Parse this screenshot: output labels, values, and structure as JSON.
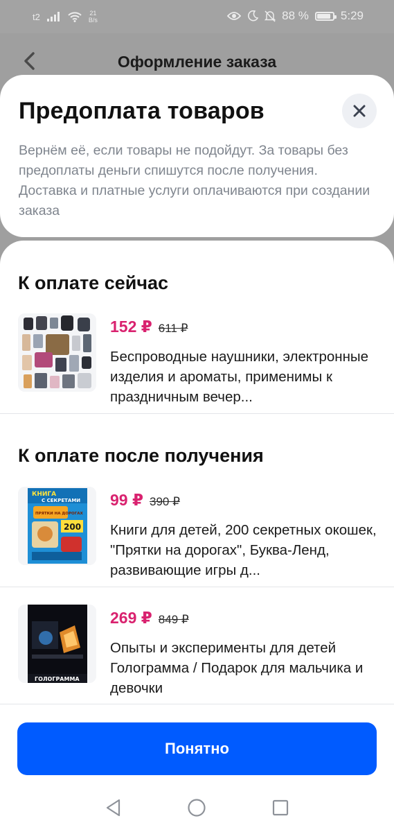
{
  "status_bar": {
    "network": "t2",
    "data_rate": "21",
    "data_rate_unit": "B/s",
    "battery": "88 %",
    "battery_level": 0.88,
    "time": "5:29"
  },
  "header": {
    "title": "Оформление заказа"
  },
  "sheet": {
    "title": "Предоплата товаров",
    "description": "Вернём её, если товары не подойдут. За товары без предоплаты деньги спишутся после получения. Доставка и платные услуги оплачиваются при создании заказа"
  },
  "pay_now": {
    "title": "К оплате сейчас",
    "items": [
      {
        "price": "152 ₽",
        "old_price": "611 ₽",
        "description": "Беспроводные наушники, электронные изделия и ароматы, применимы к праздничным вечер..."
      }
    ]
  },
  "pay_later": {
    "title": "К оплате после получения",
    "items": [
      {
        "price": "99 ₽",
        "old_price": "390 ₽",
        "description": "Книги для детей, 200 секретных окошек, \"Прятки на дорогах\", Буква-Ленд, развивающие игры д...",
        "image_text": [
          "КНИГА",
          "С СЕКРЕТАМИ",
          "ПРЯТКИ НА ДОРОГАХ",
          "200"
        ]
      },
      {
        "price": "269 ₽",
        "old_price": "849 ₽",
        "description": "Опыты и эксперименты для детей Голограмма / Подарок для мальчика и девочки",
        "image_text": [
          "ГОЛОГРАММА"
        ]
      }
    ]
  },
  "actions": {
    "ok_label": "Понятно"
  },
  "icons": {
    "back": "chevron-left-icon",
    "close": "close-icon",
    "nav_back": "triangle-back-icon",
    "nav_home": "circle-home-icon",
    "nav_recent": "square-recent-icon"
  },
  "colors": {
    "accent": "#005bff",
    "price": "#d9226f",
    "muted_text": "#7f858e",
    "overlay": "#9f9f9f"
  }
}
